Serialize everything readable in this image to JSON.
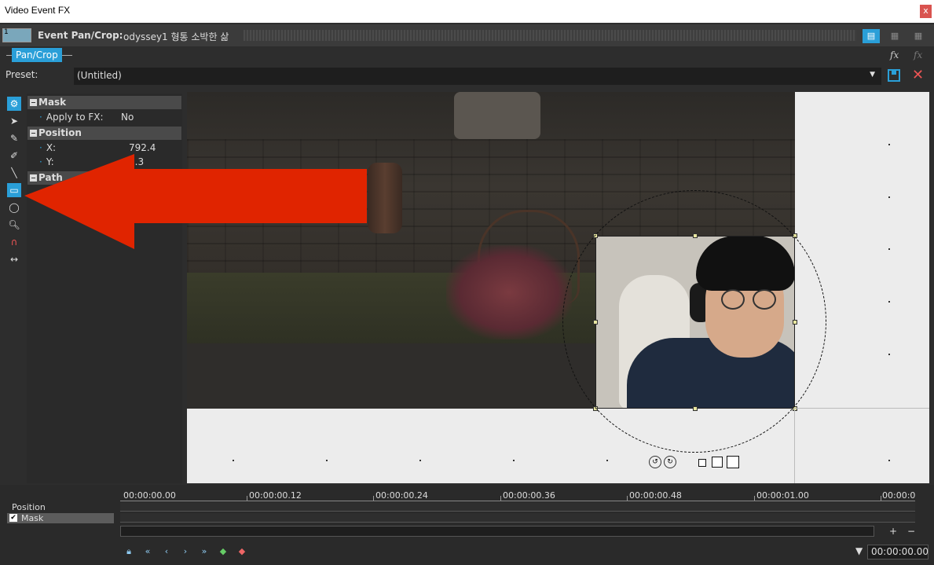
{
  "window": {
    "title": "Video Event FX",
    "close": "x"
  },
  "fx_header": {
    "thumb_number": "1",
    "title": "Event Pan/Crop:",
    "subtitle": "odyssey1 형통 소박한 삶"
  },
  "chain": {
    "active": "Pan/Crop",
    "fx_add_icon": "fx",
    "fx_remove_icon": "fx"
  },
  "preset": {
    "label": "Preset:",
    "value": "(Untitled)"
  },
  "properties": {
    "mask": {
      "heading": "Mask",
      "apply_label": "Apply to FX:",
      "apply_value": "No"
    },
    "position": {
      "heading": "Position",
      "x_label": "X:",
      "x_value": "792.4",
      "y_label": "Y:",
      "y_value": "0.3"
    },
    "path": {
      "heading": "Path"
    }
  },
  "tools": [
    "gear-icon",
    "pointer-icon",
    "pen-icon",
    "pen-add-icon",
    "line-icon",
    "rectangle-icon",
    "ellipse-icon",
    "zoom-icon",
    "magnet-icon",
    "resize-icon"
  ],
  "timeline": {
    "tracks": [
      "Position",
      "Mask"
    ],
    "ruler": [
      "00:00:00.00",
      "00:00:00.12",
      "00:00:00.24",
      "00:00:00.36",
      "00:00:00.48",
      "00:00:01.00",
      "00:00:0"
    ],
    "current_time": "00:00:00.00"
  },
  "colors": {
    "accent": "#2a9fd8",
    "arrow": "#e02400"
  }
}
